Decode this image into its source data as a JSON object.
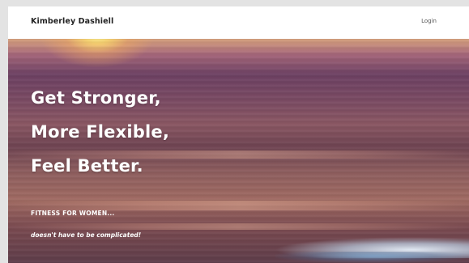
{
  "navbar": {
    "brand": "Kimberley Dashiell",
    "login": "Login"
  },
  "hero": {
    "headline_lines": [
      "Get Stronger,",
      "More Flexible,",
      "Feel Better."
    ],
    "tagline": "FITNESS FOR WOMEN...",
    "subtagline": "doesn't have to be complicated!"
  },
  "colors": {
    "navbar_bg": "#ffffff",
    "brand_text": "#222222",
    "hero_text": "#ffffff",
    "page_bg": "#e3e3e3"
  }
}
